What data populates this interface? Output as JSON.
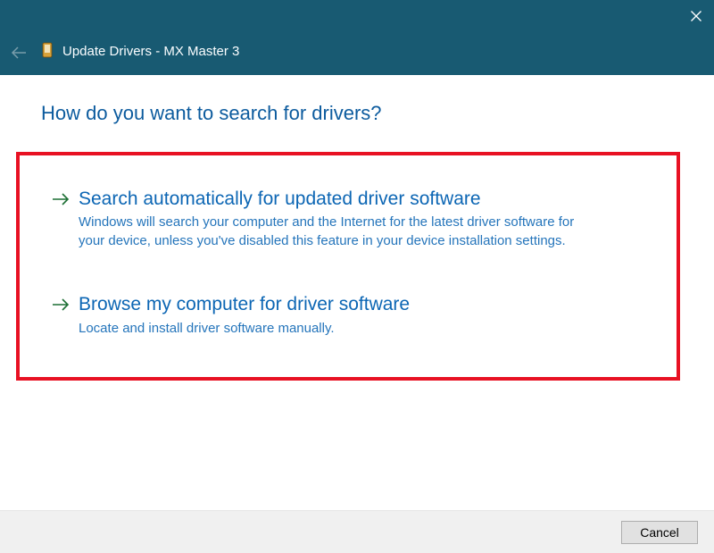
{
  "window": {
    "title": "Update Drivers - MX Master 3"
  },
  "main": {
    "heading": "How do you want to search for drivers?",
    "options": [
      {
        "title": "Search automatically for updated driver software",
        "desc": "Windows will search your computer and the Internet for the latest driver software for your device, unless you've disabled this feature in your device installation settings."
      },
      {
        "title": "Browse my computer for driver software",
        "desc": "Locate and install driver software manually."
      }
    ]
  },
  "footer": {
    "cancel": "Cancel"
  }
}
